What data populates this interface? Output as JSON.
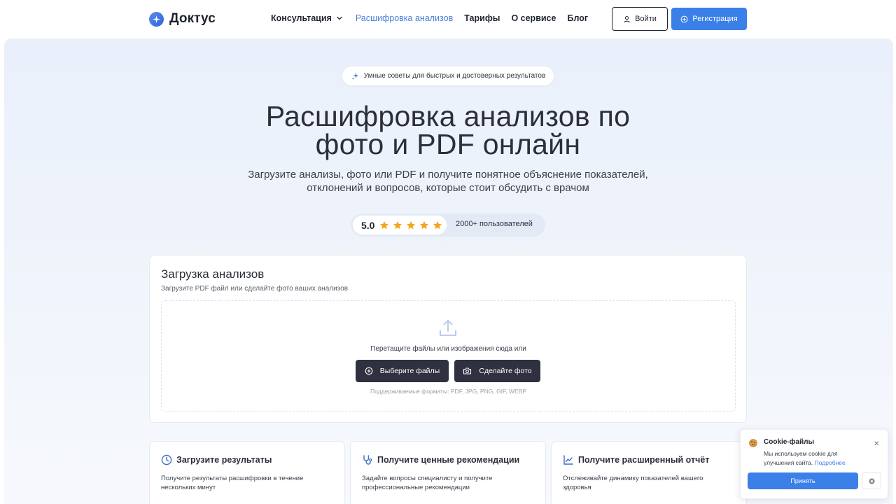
{
  "brand": {
    "name": "Доктус",
    "logo_icon": "sparkle-cross-logo",
    "accent": "#3b7fe8"
  },
  "nav": {
    "items": [
      {
        "label": "Консультация",
        "has_dropdown": true,
        "active": false
      },
      {
        "label": "Расшифровка анализов",
        "active": true
      },
      {
        "label": "Тарифы",
        "active": false
      },
      {
        "label": "О сервисе",
        "active": false
      },
      {
        "label": "Блог",
        "active": false
      }
    ],
    "login_label": "Войти",
    "register_label": "Регистрация"
  },
  "hero": {
    "pill": "Умные советы для быстрых и достоверных результатов",
    "title_line1": "Расшифровка анализов по",
    "title_line2": "фото и PDF онлайн",
    "subtitle_line1": "Загрузите анализы, фото или PDF и получите понятное объяснение показателей,",
    "subtitle_line2": "отклонений и вопросов, которые стоит обсудить с врачом",
    "rating": {
      "score": "5.0",
      "stars": 5,
      "users": "2000+ пользователей"
    }
  },
  "upload": {
    "title": "Загрузка анализов",
    "subtitle": "Загрузите PDF файл или сделайте фото ваших анализов",
    "drop_text": "Перетащите файлы или изображения сюда или",
    "choose_files": "Выберите файлы",
    "take_photo": "Сделайте фото",
    "formats": "Поддерживаемые форматы: PDF, JPG, PNG, GIF, WEBP"
  },
  "features": [
    {
      "icon": "clock-icon",
      "title": "Загрузите результаты",
      "text": "Получите результаты расшифровки в течение нескольких минут"
    },
    {
      "icon": "stethoscope-icon",
      "title": "Получите ценные рекомендации",
      "text": "Задайте вопросы специалисту и получите профессиональные рекомендации"
    },
    {
      "icon": "chart-line-icon",
      "title": "Получите расширенный отчёт",
      "text": "Отслеживайте динамику показателей вашего здоровья"
    }
  ],
  "cookie": {
    "title": "Cookie-файлы",
    "text": "Мы используем cookie для улучшения сайта.",
    "link": "Подробнее",
    "accept": "Принять"
  }
}
